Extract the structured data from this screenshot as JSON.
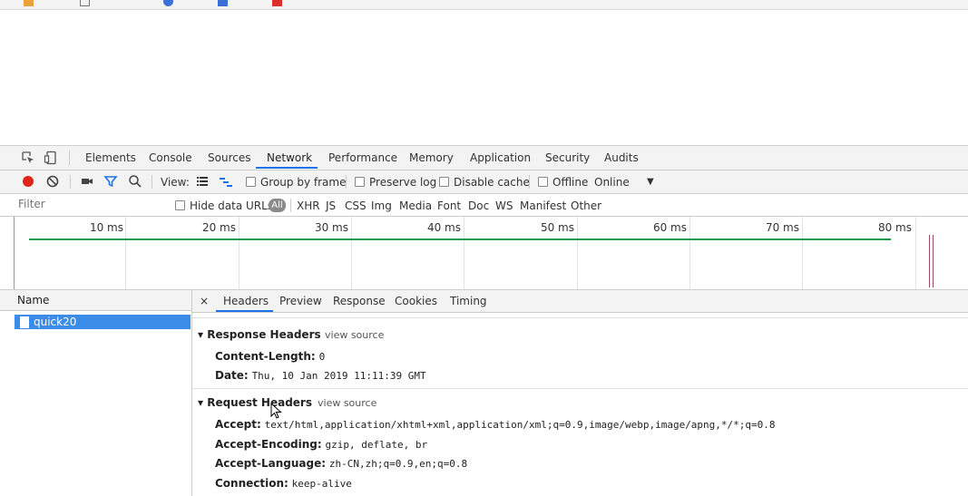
{
  "devtools": {
    "tabs": [
      "Elements",
      "Console",
      "Sources",
      "Network",
      "Performance",
      "Memory",
      "Application",
      "Security",
      "Audits"
    ],
    "active_tab": "Network"
  },
  "toolbar": {
    "view_label": "View:",
    "group_by_frame": "Group by frame",
    "preserve_log": "Preserve log",
    "disable_cache": "Disable cache",
    "offline": "Offline",
    "throttle": "Online",
    "throttle_arrow": "▼"
  },
  "filterbar": {
    "filter_placeholder": "Filter",
    "hide_data_urls": "Hide data URLs",
    "all": "All",
    "types": [
      "XHR",
      "JS",
      "CSS",
      "Img",
      "Media",
      "Font",
      "Doc",
      "WS",
      "Manifest",
      "Other"
    ]
  },
  "timeline": {
    "ticks": [
      "10 ms",
      "20 ms",
      "30 ms",
      "40 ms",
      "50 ms",
      "60 ms",
      "70 ms",
      "80 ms"
    ]
  },
  "requests": {
    "column_name": "Name",
    "items": [
      "quick20"
    ]
  },
  "detail": {
    "close": "×",
    "tabs": [
      "Headers",
      "Preview",
      "Response",
      "Cookies",
      "Timing"
    ],
    "active_tab": "Headers",
    "response_headers": {
      "title": "Response Headers",
      "view_source": "view source",
      "items": [
        {
          "key": "Content-Length:",
          "value": "0"
        },
        {
          "key": "Date:",
          "value": "Thu, 10 Jan 2019 11:11:39 GMT"
        }
      ]
    },
    "request_headers": {
      "title": "Request Headers",
      "view_source": "view source",
      "items": [
        {
          "key": "Accept:",
          "value": "text/html,application/xhtml+xml,application/xml;q=0.9,image/webp,image/apng,*/*;q=0.8"
        },
        {
          "key": "Accept-Encoding:",
          "value": "gzip, deflate, br"
        },
        {
          "key": "Accept-Language:",
          "value": "zh-CN,zh;q=0.9,en;q=0.8"
        },
        {
          "key": "Connection:",
          "value": "keep-alive"
        }
      ]
    }
  }
}
